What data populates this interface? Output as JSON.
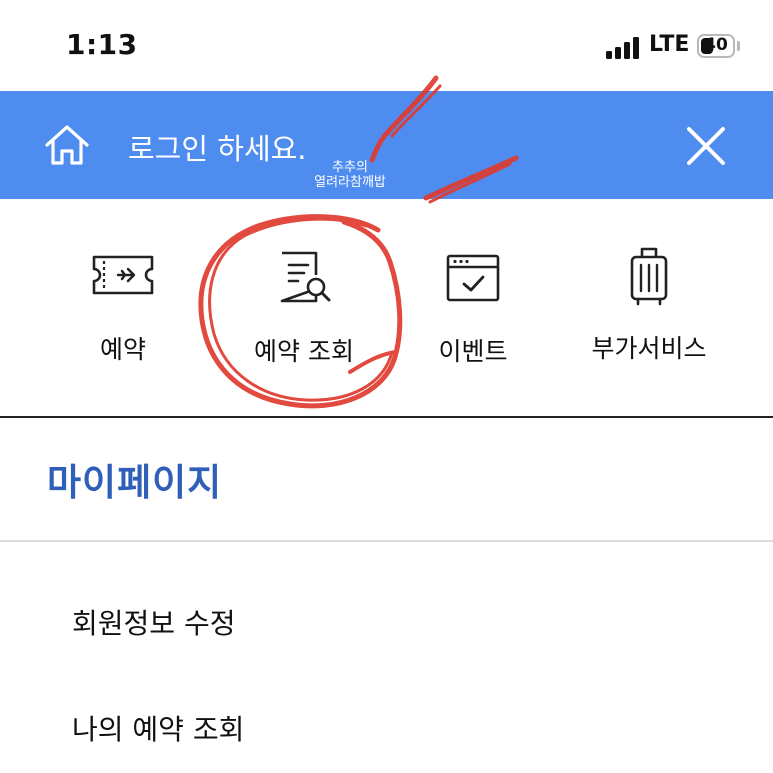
{
  "status_bar": {
    "time": "1:13",
    "network": "LTE",
    "battery": "40",
    "battery_level_percent": 40
  },
  "header": {
    "home_icon": "home-icon",
    "login_prompt": "로그인 하세요.",
    "close_icon": "close-icon",
    "background_color": "#4f8cf0"
  },
  "quick_menu": {
    "items": [
      {
        "label": "예약",
        "icon": "ticket-icon"
      },
      {
        "label": "예약 조회",
        "icon": "document-search-icon"
      },
      {
        "label": "이벤트",
        "icon": "calendar-check-icon"
      },
      {
        "label": "부가서비스",
        "icon": "luggage-icon"
      }
    ]
  },
  "mypage": {
    "title": "마이페이지",
    "title_color": "#2f5fb9",
    "items": [
      {
        "label": "회원정보 수정"
      },
      {
        "label": "나의 예약 조회"
      }
    ]
  },
  "watermark": {
    "line1": "추추의",
    "line2": "열려라참깨밥"
  },
  "annotation_color": "#e03a2f"
}
